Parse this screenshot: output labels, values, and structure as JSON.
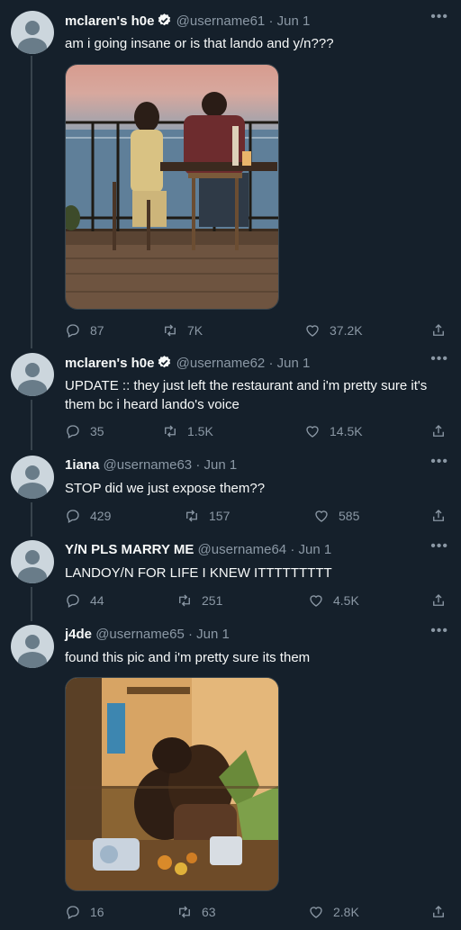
{
  "tweets": [
    {
      "name": "mclaren's h0e",
      "verified": true,
      "handle": "@username61",
      "date": "Jun 1",
      "text": "am i going insane or is that lando and y/n???",
      "has_media": true,
      "stats": {
        "replies": "87",
        "retweets": "7K",
        "likes": "37.2K"
      }
    },
    {
      "name": "mclaren's h0e",
      "verified": true,
      "handle": "@username62",
      "date": "Jun 1",
      "text": "UPDATE :: they just left the restaurant and i'm pretty sure it's them bc i heard lando's voice",
      "has_media": false,
      "stats": {
        "replies": "35",
        "retweets": "1.5K",
        "likes": "14.5K"
      }
    },
    {
      "name": "1iana",
      "verified": false,
      "handle": "@username63",
      "date": "Jun 1",
      "text": "STOP did we just expose them??",
      "has_media": false,
      "stats": {
        "replies": "429",
        "retweets": "157",
        "likes": "585"
      }
    },
    {
      "name": "Y/N PLS MARRY ME",
      "verified": false,
      "handle": "@username64",
      "date": "Jun 1",
      "text": "LANDOY/N FOR LIFE I KNEW ITTTTTTTTT",
      "has_media": false,
      "stats": {
        "replies": "44",
        "retweets": "251",
        "likes": "4.5K"
      }
    },
    {
      "name": "j4de",
      "verified": false,
      "handle": "@username65",
      "date": "Jun 1",
      "text": "found this pic and i'm pretty sure its them",
      "has_media": true,
      "stats": {
        "replies": "16",
        "retweets": "63",
        "likes": "2.8K"
      }
    }
  ],
  "icons": {
    "more": "more-horizontal-icon",
    "reply": "reply-icon",
    "retweet": "retweet-icon",
    "like": "like-icon",
    "share": "share-icon",
    "verified": "verified-badge-icon"
  },
  "colors": {
    "background": "#15202b",
    "text": "#f7f9f9",
    "muted": "#8b98a5",
    "verified_badge": "#f7f9f9"
  }
}
